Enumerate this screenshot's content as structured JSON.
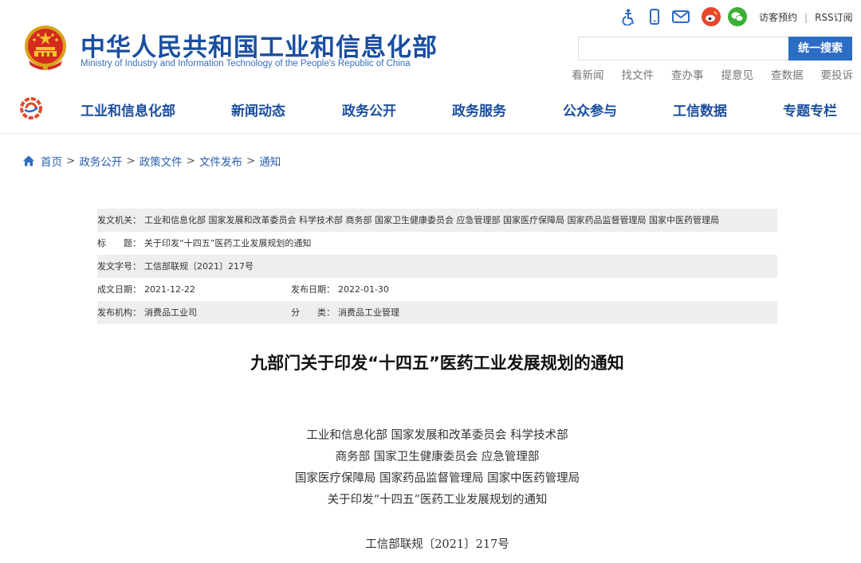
{
  "header": {
    "site_title": "中华人民共和国工业和信息化部",
    "site_subtitle": "Ministry of Industry and Information Technology of the People's Republic of China",
    "top_links": [
      "访客预约",
      "RSS订阅"
    ],
    "search": {
      "placeholder": "",
      "button_label": "统一搜索"
    },
    "quick_links": [
      "看新闻",
      "找文件",
      "查办事",
      "提意见",
      "查数据",
      "要投诉"
    ],
    "icons": [
      "accessibility-icon",
      "mobile-icon",
      "mail-icon",
      "weibo-icon",
      "wechat-icon"
    ],
    "brand_color": "#1a4fa0",
    "accent_color": "#2b6cc4"
  },
  "nav": {
    "items": [
      "工业和信息化部",
      "新闻动态",
      "政务公开",
      "政务服务",
      "公众参与",
      "工信数据",
      "专题专栏"
    ]
  },
  "breadcrumb": [
    "首页",
    "政务公开",
    "政策文件",
    "文件发布",
    "通知"
  ],
  "meta": {
    "issuer_label": "发文机关：",
    "issuer": "工业和信息化部 国家发展和改革委员会 科学技术部 商务部 国家卫生健康委员会 应急管理部 国家医疗保障局 国家药品监督管理局 国家中医药管理局",
    "title_label": "标　　题：",
    "title": "关于印发“十四五”医药工业发展规划的通知",
    "doc_no_label": "发文字号：",
    "doc_no": "工信部联规〔2021〕217号",
    "created_label": "成文日期：",
    "created": "2021-12-22",
    "published_label": "发布日期：",
    "published": "2022-01-30",
    "org_label": "发布机构：",
    "org": "消费品工业司",
    "category_label": "分　　类：",
    "category": "消费品工业管理"
  },
  "article": {
    "title": "九部门关于印发“十四五”医药工业发展规划的通知",
    "lines": [
      "工业和信息化部 国家发展和改革委员会 科学技术部",
      "商务部 国家卫生健康委员会 应急管理部",
      "国家医疗保障局 国家药品监督管理局 国家中医药管理局",
      "关于印发“十四五”医药工业发展规划的通知"
    ],
    "doc_no": "工信部联规〔2021〕217号"
  }
}
